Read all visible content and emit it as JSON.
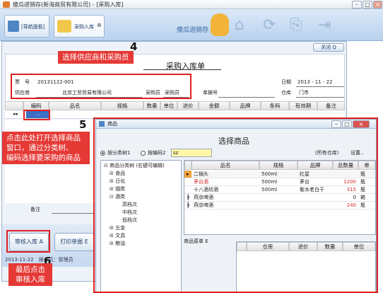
{
  "window": {
    "title": "傻瓜进销存(新海商贸有限公司) - [采购入库]"
  },
  "toolbar": {
    "tabs": [
      {
        "label": "[导航面板]"
      },
      {
        "label": "采购入库"
      }
    ],
    "brand": "傻瓜进销存"
  },
  "form": {
    "close_label": "关闭 Q",
    "title": "采购入库单",
    "ticket_label": "票　号",
    "ticket_value": "20131122-001",
    "date_label": "日期",
    "date_value": "2013 - 11 - 22",
    "supplier_label": "供应商",
    "supplier_value": "北京工贸贸易有限公司",
    "buyer_label": "采购员",
    "buyer_value": "采购员",
    "receipt_label": "单据号",
    "warehouse_label": "仓库",
    "warehouse_value": "门市",
    "columns": [
      "编码",
      "品名",
      "规格",
      "数量",
      "单位",
      "进价",
      "金额",
      "品牌",
      "条码",
      "有效期",
      "备注"
    ],
    "row_marker": "▸▸",
    "ellipsis": "...",
    "note_label": "备注",
    "audit_button": "审核入库 A",
    "print_button": "打印单据 E",
    "status_text": "2013-11-22　操作员：管理员"
  },
  "annotations": {
    "a4_num": "4",
    "a4_text": "选择供应商和采购员",
    "a5_num": "5",
    "a5_text_lines": [
      "点击此处打开选择商品",
      "窗口，通过分类树、",
      "编码选择要采购的商品"
    ],
    "a6_num": "6",
    "a6_text_lines": [
      "最后点击",
      "审核入库"
    ]
  },
  "dialog": {
    "window_title": "商品",
    "title": "选择商品",
    "radio1": "按分类树1",
    "radio2": "按编码2",
    "search_value": "sz",
    "all_warehouse": "(所有仓库)",
    "settings": "设置..",
    "tree": [
      {
        "label": "商品分类树 (右键可编辑)",
        "level": 0
      },
      {
        "label": "食品",
        "level": 1
      },
      {
        "label": "日化",
        "level": 1
      },
      {
        "label": "烟类",
        "level": 1
      },
      {
        "label": "酒类",
        "level": 1
      },
      {
        "label": "高档次",
        "level": 2
      },
      {
        "label": "中档次",
        "level": 2
      },
      {
        "label": "低档次",
        "level": 2
      },
      {
        "label": "五金",
        "level": 1
      },
      {
        "label": "文具",
        "level": 1
      },
      {
        "label": "粮油",
        "level": 1
      }
    ],
    "grid_columns": [
      "品名",
      "规格",
      "品牌",
      "总数量",
      "单"
    ],
    "grid_rows": [
      {
        "mark": "▸",
        "name": "二锅头",
        "spec": "500ml",
        "brand": "红星",
        "qty": "",
        "unit": "瓶",
        "color": "#222222"
      },
      {
        "mark": "",
        "name": "茅台酒",
        "spec": "500ml",
        "brand": "茅台",
        "qty": "1200",
        "unit": "瓶",
        "color": "#d32f2f"
      },
      {
        "mark": "",
        "name": "十八酒坊酒",
        "spec": "500ml",
        "brand": "衡水老白干",
        "qty": "315",
        "unit": "瓶",
        "color": "#222222"
      },
      {
        "mark": "┣",
        "name": "燕京啤酒",
        "spec": "",
        "brand": "",
        "qty": "0",
        "unit": "箱",
        "color": "#222222"
      },
      {
        "mark": "┣",
        "name": "燕京啤酒",
        "spec": "",
        "brand": "",
        "qty": "240",
        "unit": "瓶",
        "color": "#222222"
      }
    ],
    "product_list_label": "商品菜单 E",
    "stock_columns": [
      "仓库",
      "进价",
      "数量",
      "单位"
    ]
  }
}
